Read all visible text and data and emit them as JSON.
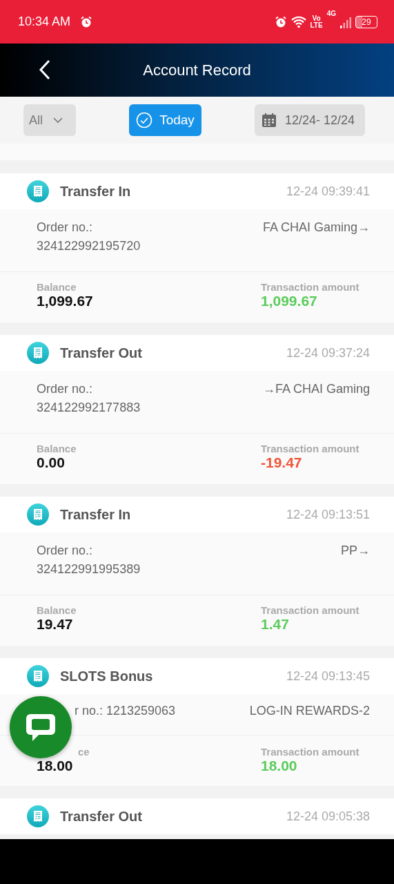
{
  "status_bar": {
    "time": "10:34 AM",
    "volte_top": "Vo",
    "volte_bottom": "LTE",
    "network": "4G",
    "battery": "29"
  },
  "header": {
    "title": "Account Record"
  },
  "filters": {
    "type_select": "All",
    "today": {
      "label": "Today",
      "selected": true
    },
    "date_range": "12/24- 12/24"
  },
  "records": [
    {
      "kind": "transfer",
      "title": "Transfer In",
      "time": "12-24 09:39:41",
      "order_label": "Order no.:",
      "order_no": "324122992195720",
      "target": "FA CHAI Gaming→",
      "balance_label": "Balance",
      "balance": "1,099.67",
      "amount_label": "Transaction amount",
      "amount": "1,099.67",
      "color": "#5ccc5c",
      "covered": false
    },
    {
      "kind": "transfer",
      "title": "Transfer Out",
      "time": "12-24 09:37:24",
      "order_label": "Order no.:",
      "order_no": "324122992177883",
      "target": "→FA CHAI Gaming",
      "balance_label": "Balance",
      "balance": "0.00",
      "amount_label": "Transaction amount",
      "amount": "-19.47",
      "color": "#f0553a",
      "covered": false
    },
    {
      "kind": "transfer",
      "title": "Transfer In",
      "time": "12-24 09:13:51",
      "order_label": "Order no.:",
      "order_no": "324122991995389",
      "target": "PP→",
      "balance_label": "Balance",
      "balance": "19.47",
      "amount_label": "Transaction amount",
      "amount": "1.47",
      "color": "#5ccc5c",
      "covered": false
    },
    {
      "kind": "bonus",
      "title": "SLOTS Bonus",
      "time": "12-24 09:13:45",
      "order_text": "r no.: 1213259063",
      "target": "LOG-IN REWARDS-2",
      "balance_label": "ce",
      "balance": "18.00",
      "amount_label": "Transaction amount",
      "amount": "18.00",
      "color": "#5ccc5c",
      "covered": true
    },
    {
      "kind": "header_only",
      "title": "Transfer Out",
      "time": "12-24 09:05:38"
    }
  ]
}
